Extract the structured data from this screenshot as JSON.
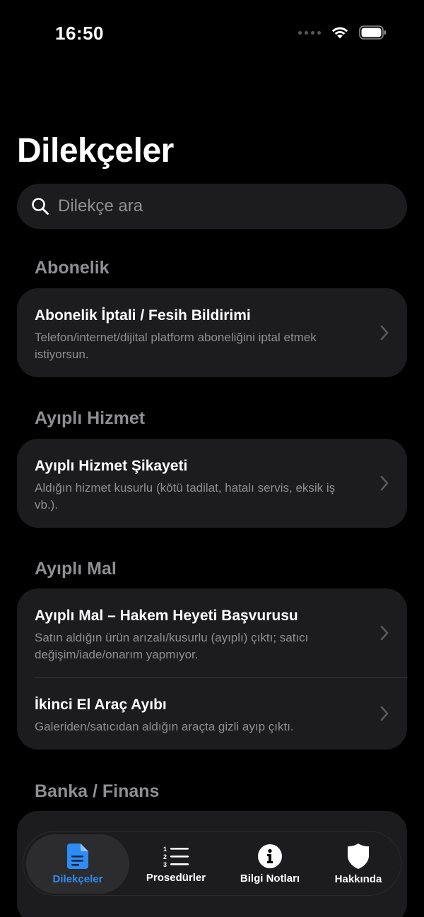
{
  "status_bar": {
    "time": "16:50"
  },
  "page": {
    "title": "Dilekçeler"
  },
  "search": {
    "placeholder": "Dilekçe ara"
  },
  "sections": [
    {
      "header": "Abonelik",
      "items": [
        {
          "title": "Abonelik İptali / Fesih Bildirimi",
          "subtitle": "Telefon/internet/dijital platform aboneliğini iptal etmek istiyorsun."
        }
      ]
    },
    {
      "header": "Ayıplı Hizmet",
      "items": [
        {
          "title": "Ayıplı Hizmet Şikayeti",
          "subtitle": "Aldığın hizmet kusurlu (kötü tadilat, hatalı servis, eksik iş vb.)."
        }
      ]
    },
    {
      "header": "Ayıplı Mal",
      "items": [
        {
          "title": "Ayıplı Mal – Hakem Heyeti Başvurusu",
          "subtitle": "Satın aldığın ürün arızalı/kusurlu (ayıplı) çıktı; satıcı değişim/iade/onarım yapmıyor."
        },
        {
          "title": "İkinci El Araç Ayıbı",
          "subtitle": "Galeriden/satıcıdan aldığın araçta gizli ayıp çıktı."
        }
      ]
    },
    {
      "header": "Banka / Finans",
      "items": []
    }
  ],
  "tab_bar": {
    "tabs": [
      {
        "label": "Dilekçeler",
        "icon": "document-icon",
        "active": true
      },
      {
        "label": "Prosedürler",
        "icon": "numbered-list-icon",
        "active": false
      },
      {
        "label": "Bilgi Notları",
        "icon": "info-icon",
        "active": false
      },
      {
        "label": "Hakkında",
        "icon": "shield-icon",
        "active": false
      }
    ]
  },
  "colors": {
    "background": "#000000",
    "card": "#1c1c1e",
    "secondary_text": "#8e8e93",
    "accent": "#2f8cf3"
  }
}
